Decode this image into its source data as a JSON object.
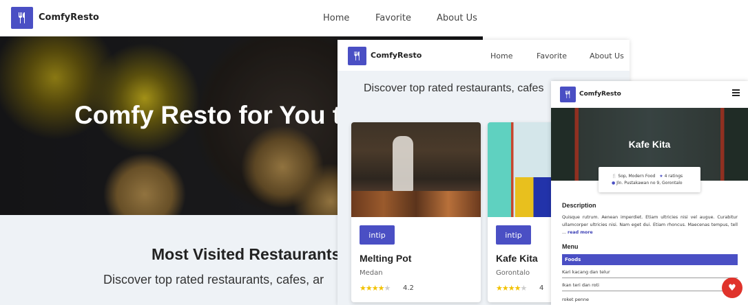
{
  "brand": "ComfyResto",
  "nav": {
    "home": "Home",
    "favorite": "Favorite",
    "about": "About Us"
  },
  "desktop": {
    "hero_title": "Comfy Resto for You t",
    "section_title": "Most Visited Restaurants",
    "section_subtitle": "Discover top rated restaurants, cafes, ar"
  },
  "tablet": {
    "subtitle": "Discover top rated restaurants, cafes",
    "cards": [
      {
        "button": "intip",
        "name": "Melting Pot",
        "city": "Medan",
        "rating": "4.2",
        "stars_filled": 4,
        "stars_total": 5
      },
      {
        "button": "intip",
        "name": "Kafe Kita",
        "city": "Gorontalo",
        "rating": "4",
        "stars_filled": 4,
        "stars_total": 5
      }
    ]
  },
  "mobile": {
    "restaurant_name": "Kafe Kita",
    "categories": "Sop, Modern Food",
    "ratings": "4 ratings",
    "address": "Jln. Pustakawan no 9, Gorontalo",
    "description_heading": "Description",
    "description": "Quisque rutrum. Aenean imperdiet. Etiam ultricies nisi vel augue. Curabitur ullamcorper ultricies nisi. Nam eget dui. Etiam rhoncus. Maecenas tempus, tell ...",
    "read_more": "read more",
    "menu_heading": "Menu",
    "foods_label": "Foods",
    "foods": [
      "Kari kacang dan telur",
      "Ikan teri dan roti",
      "roket penne"
    ]
  },
  "colors": {
    "accent": "#4a4fc4",
    "star": "#f2c200",
    "favorite": "#e0332b"
  },
  "icons": [
    "fork-knife-icon",
    "star-icon",
    "pin-icon",
    "menu-icon",
    "heart-icon"
  ]
}
